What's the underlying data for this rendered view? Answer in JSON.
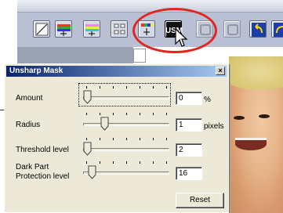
{
  "dialog": {
    "title": "Unsharp Mask",
    "close_glyph": "×",
    "settings": [
      {
        "label_lines": [
          "Amount"
        ],
        "value": "0",
        "unit": "%",
        "level": 0.0
      },
      {
        "label_lines": [
          "Radius"
        ],
        "value": "1",
        "unit": "pixels",
        "level": 0.22
      },
      {
        "label_lines": [
          "Threshold level"
        ],
        "value": "2",
        "unit": "",
        "level": 0.0
      },
      {
        "label_lines": [
          "Dark Part",
          "Protection level"
        ],
        "value": "16",
        "unit": "",
        "level": 0.06
      }
    ],
    "reset_label": "Reset"
  },
  "toolbar": {
    "buttons": [
      {
        "icon": "curves-icon",
        "state": "normal"
      },
      {
        "icon": "color-balance-icon",
        "state": "normal"
      },
      {
        "icon": "hue-saturation-icon",
        "state": "normal"
      },
      {
        "icon": "selective-color-icon",
        "state": "normal"
      },
      {
        "icon": "color-channel-icon",
        "state": "normal"
      },
      {
        "icon": "usm-icon",
        "state": "highlighted",
        "text": "USM"
      },
      {
        "icon": "panel-icon",
        "state": "disabled"
      },
      {
        "icon": "window-icon",
        "state": "disabled"
      },
      {
        "icon": "undo-icon",
        "state": "normal"
      },
      {
        "icon": "redo-icon",
        "state": "normal"
      }
    ],
    "highlight_color": "#e0261f"
  },
  "colors": {
    "accent": "#0a246a",
    "toolbar": "#b9c0d3",
    "dialog": "#ece9d8"
  }
}
